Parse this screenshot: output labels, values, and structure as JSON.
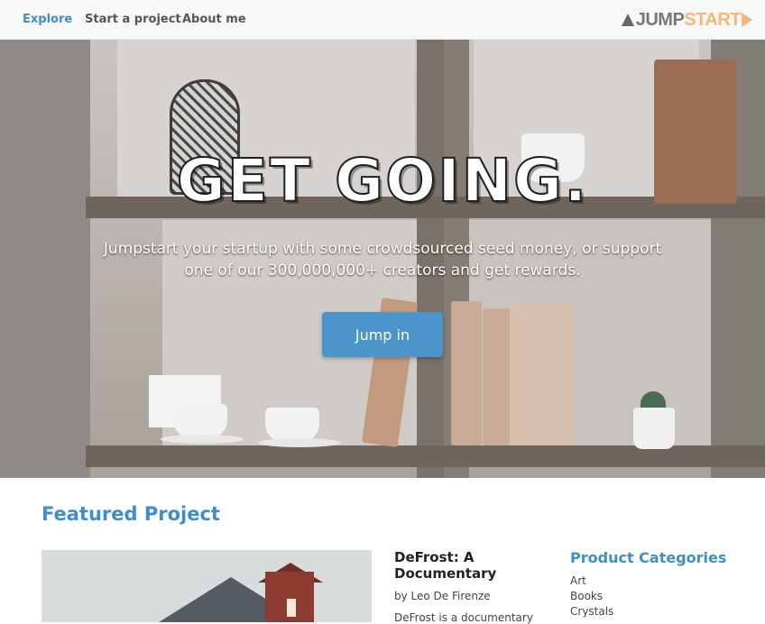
{
  "nav": {
    "links": [
      "Explore",
      "Start a project",
      "About me"
    ],
    "brand": {
      "part1": "JUMP",
      "part2": "START"
    }
  },
  "hero": {
    "title": "Get going.",
    "subtitle": "Jumpstart your startup with some crowdsourced seed money, or support one of our 300,000,000+ creators and get rewards.",
    "button": "Jump in"
  },
  "featured": {
    "heading": "Featured Project",
    "project": {
      "title": "DeFrost: A Documentary",
      "author": "by Leo De Firenze",
      "description": "DeFrost is a documentary"
    }
  },
  "categories": {
    "heading": "Product Categories",
    "items": [
      "Art",
      "Books",
      "Crystals"
    ]
  },
  "colors": {
    "accent": "#3d8ec9",
    "button": "#4b95cb",
    "brand_orange": "#f4b77a"
  }
}
